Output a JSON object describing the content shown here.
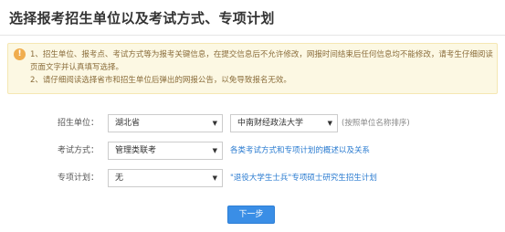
{
  "page": {
    "title": "选择报考招生单位以及考试方式、专项计划"
  },
  "notice": {
    "icon": "warning-icon",
    "icon_glyph": "!",
    "line1": "1、招生单位、报考点、考试方式等为报考关键信息，在提交信息后不允许修改，网报时间结束后任何信息均不能修改，请考生仔细阅读页面文字并认真填写选择。",
    "line2": "2、请仔细阅读选择省市和招生单位后弹出的网报公告，以免导致报名无效。"
  },
  "form": {
    "unit": {
      "label": "招生单位：",
      "province_value": "湖北省",
      "school_value": "中南财经政法大学",
      "hint": "(按照单位名称排序)"
    },
    "exam_mode": {
      "label": "考试方式：",
      "value": "管理类联考",
      "link": "各类考试方式和专项计划的概述以及关系"
    },
    "special_plan": {
      "label": "专项计划：",
      "value": "无",
      "link": "\"退役大学生士兵\"专项硕士研究生招生计划"
    },
    "caret_glyph": "▼"
  },
  "actions": {
    "next_label": "下一步"
  },
  "colors": {
    "accent": "#3a8ee6",
    "link": "#2a7bd0",
    "notice_bg": "#fcf8e3",
    "notice_text": "#8a6d3b",
    "warning_icon": "#f0ad4e"
  }
}
